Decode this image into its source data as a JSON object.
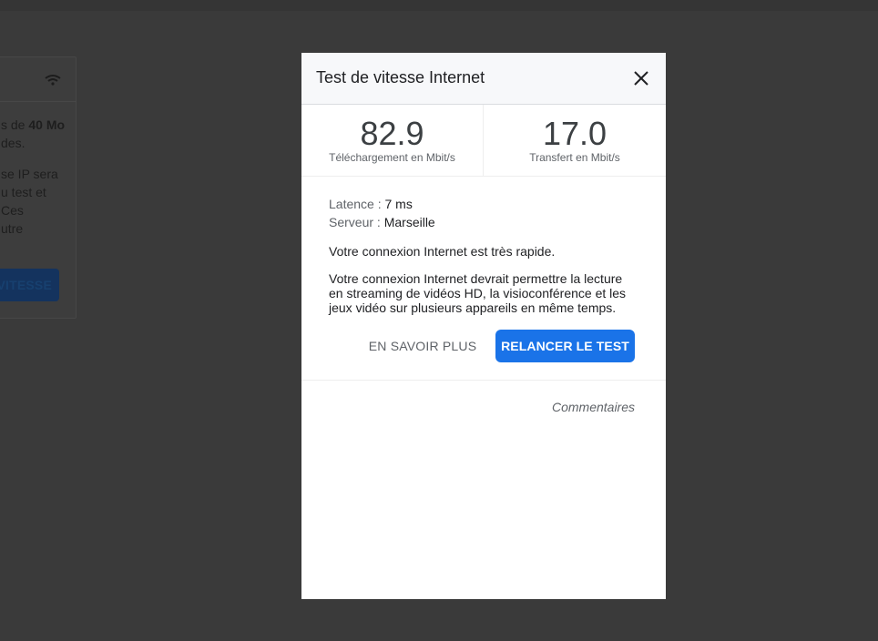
{
  "background": {
    "line1_prefix": "s de ",
    "line1_bold": "40 Mo",
    "line2": "des.",
    "line3": "se IP sera",
    "line4": "u test et",
    "line5": "Ces",
    "line6": "utre",
    "button_label": "VITESSE",
    "icon": "wifi-icon"
  },
  "modal": {
    "title": "Test de vitesse Internet",
    "close_icon": "close-icon",
    "download": {
      "value": "82.9",
      "label": "Téléchargement en Mbit/s"
    },
    "upload": {
      "value": "17.0",
      "label": "Transfert en Mbit/s"
    },
    "latency": {
      "key": "Latence : ",
      "value": "7 ms"
    },
    "server": {
      "key": "Serveur : ",
      "value": "Marseille"
    },
    "summary": "Votre connexion Internet est très rapide.",
    "description_lines": [
      "Votre connexion Internet devrait permettre la lecture",
      "en streaming de vidéos HD, la visioconférence et les",
      "jeux vidéo sur plusieurs appareils en même temps."
    ],
    "learn_more_label": "EN SAVOIR PLUS",
    "rerun_label": "RELANCER LE TEST",
    "feedback_label": "Commentaires"
  },
  "colors": {
    "overlay": "#3a3a3a",
    "accent": "#1a73e8",
    "header_bg": "#f7f8fa"
  }
}
